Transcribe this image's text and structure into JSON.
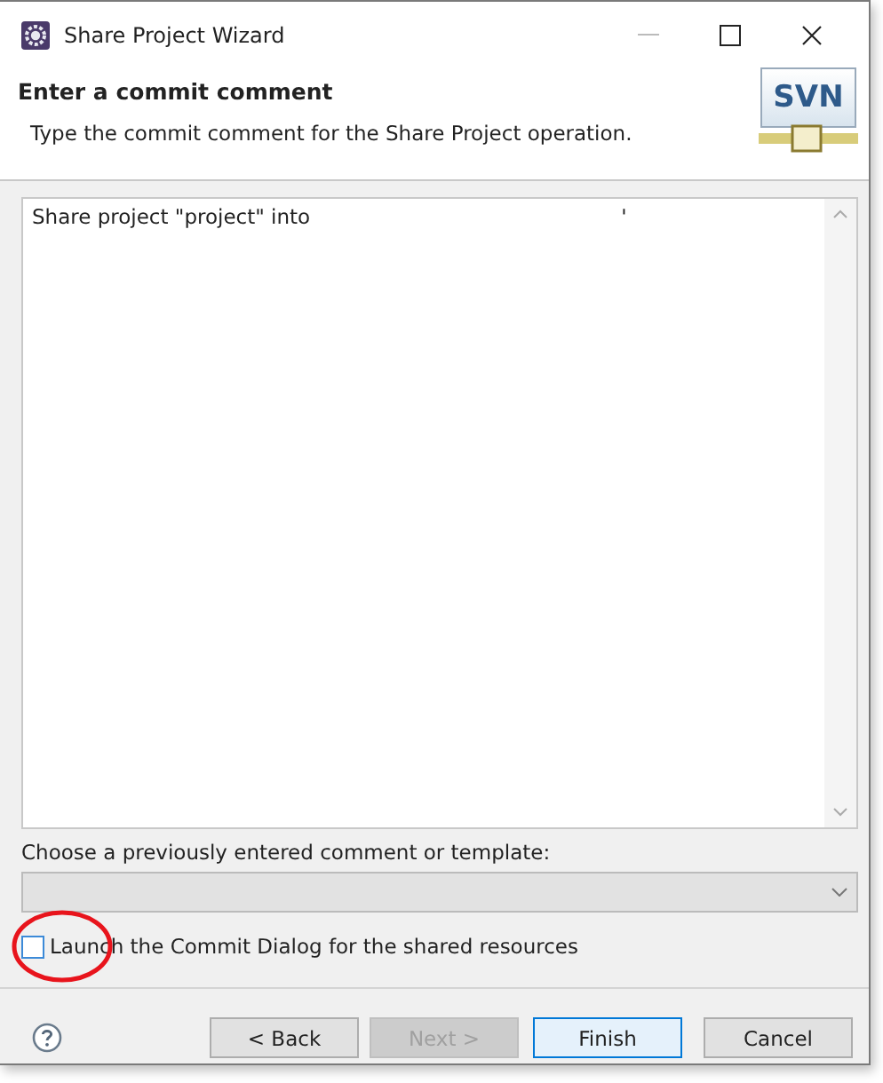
{
  "window": {
    "title": "Share Project Wizard"
  },
  "header": {
    "title": "Enter a commit comment",
    "description": "Type the commit comment for the Share Project operation.",
    "logo": "SVN"
  },
  "comment": {
    "value": "Share project \"project\" into",
    "tail": "'"
  },
  "template": {
    "label": "Choose a previously entered comment or template:",
    "disabled": true
  },
  "launch_commit_dialog": {
    "label": "Launch the Commit Dialog for the shared resources",
    "checked": false
  },
  "buttons": [
    {
      "label": "< Back",
      "disabled": false,
      "default": false
    },
    {
      "label": "Next >",
      "disabled": true,
      "default": false
    },
    {
      "label": "Finish",
      "disabled": false,
      "default": true
    },
    {
      "label": "Cancel",
      "disabled": false,
      "default": false
    }
  ],
  "annotations": [
    {
      "kind": "circle",
      "color": "#e8141c"
    }
  ]
}
